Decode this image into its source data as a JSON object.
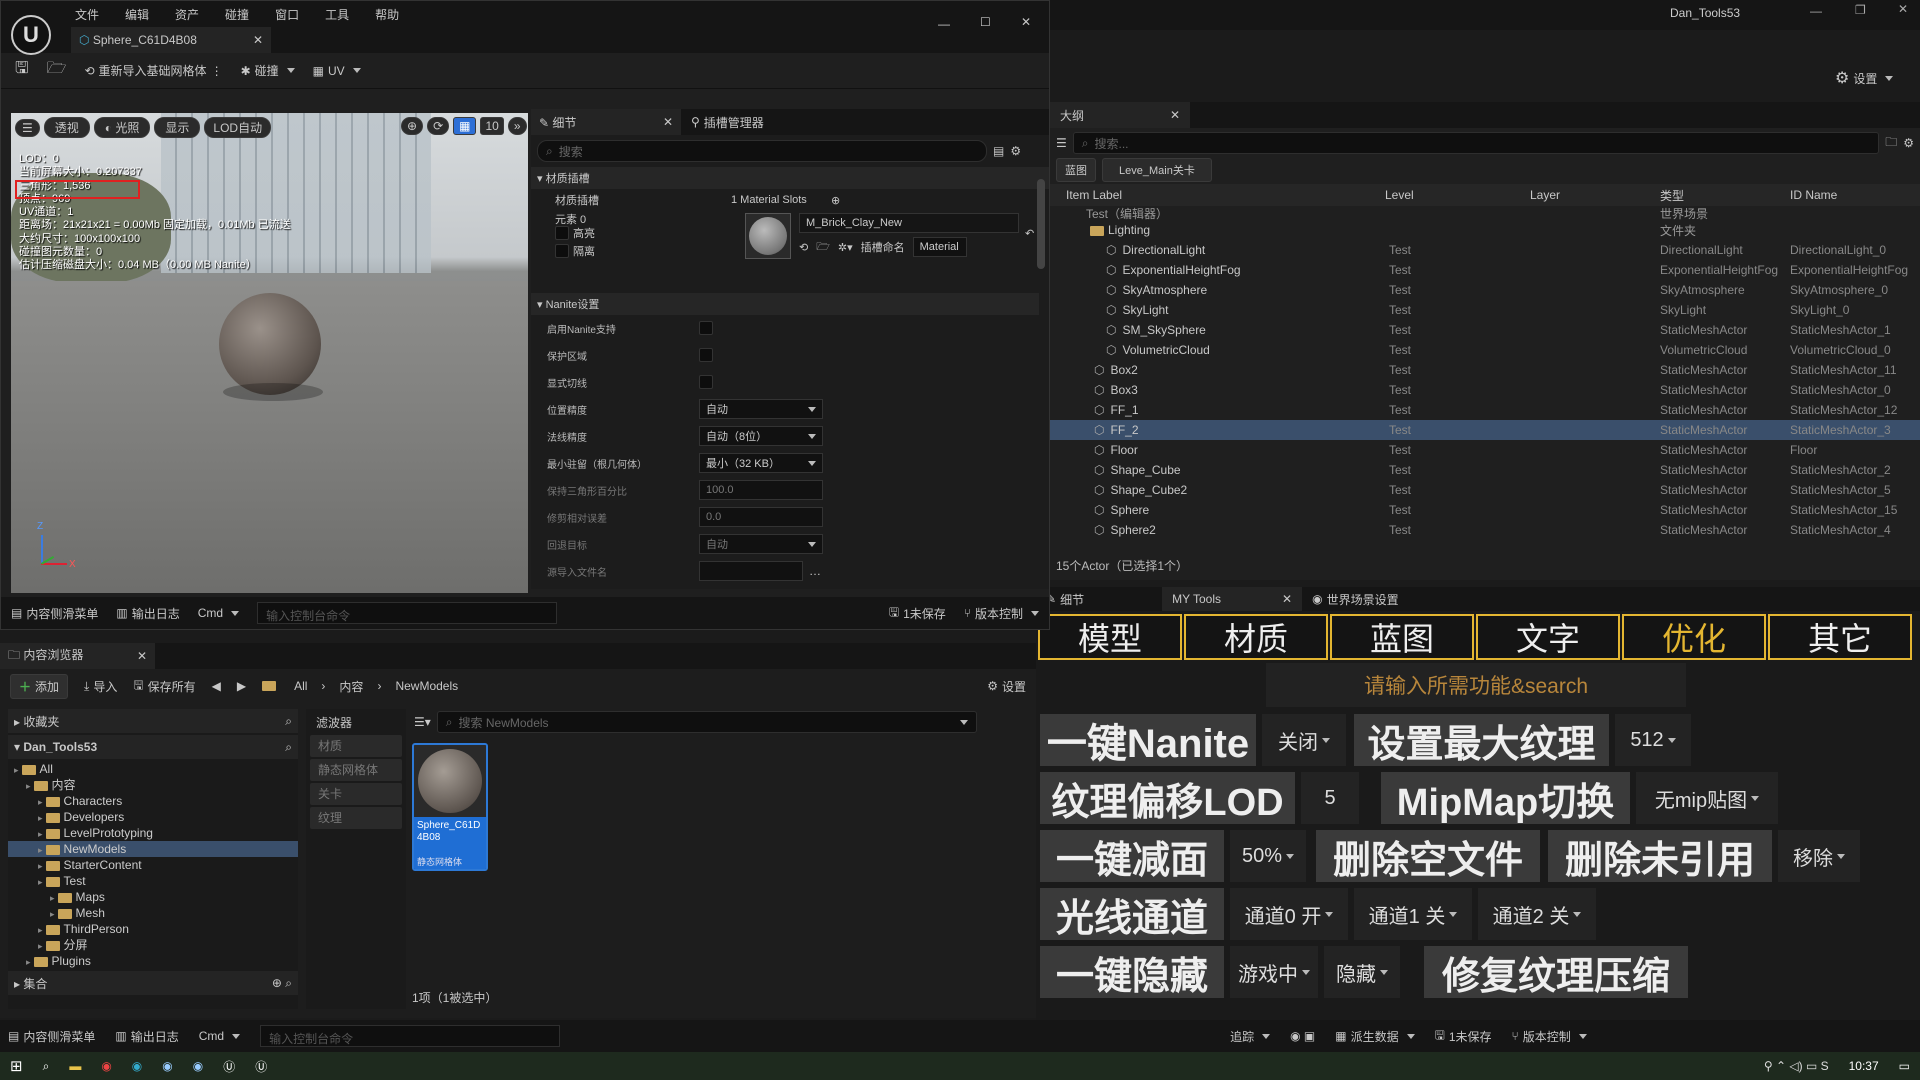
{
  "menu": [
    "文件",
    "编辑",
    "资产",
    "碰撞",
    "窗口",
    "工具",
    "帮助"
  ],
  "editor_tab": "Sphere_C61D4B08",
  "toolbar": {
    "reimport": "重新导入基础网格体",
    "collision": "碰撞",
    "uv": "UV"
  },
  "viewport": {
    "perspective": "透视",
    "lit": "光照",
    "show": "显示",
    "lod_auto": "LOD自动",
    "grid_val": "10",
    "stats": [
      "LOD：0",
      "当前屏幕大小：0.207337",
      "三角形：1,536",
      "顶点：969",
      "UV通道：1",
      "距离场：21x21x21 = 0.00Mb 固定加载，0.01Mb 已流送",
      "大约尺寸：100x100x100",
      "碰撞图元数量：0",
      "估计压缩磁盘大小：0.04 MB（0.00 MB Nanite）"
    ]
  },
  "details": {
    "tab": "细节",
    "plugin_tab": "插槽管理器",
    "search": "搜索",
    "sec_material": "材质插槽",
    "mat_slots_label": "材质插槽",
    "mat_slots_val": "1 Material Slots",
    "element": "元素 0",
    "highlight": "高亮",
    "isolate": "隔离",
    "mat_name": "M_Brick_Clay_New",
    "slot_name_label": "插槽命名",
    "slot_name_val": "Material",
    "sec_nanite": "Nanite设置",
    "rows": [
      {
        "label": "启用Nanite支持",
        "type": "check"
      },
      {
        "label": "保护区域",
        "type": "check"
      },
      {
        "label": "显式切线",
        "type": "check"
      },
      {
        "label": "位置精度",
        "type": "dd",
        "val": "自动"
      },
      {
        "label": "法线精度",
        "type": "dd",
        "val": "自动（8位）"
      },
      {
        "label": "最小驻留（根几何体）",
        "type": "dd",
        "val": "最小（32 KB）"
      },
      {
        "label": "保持三角形百分比",
        "type": "num",
        "val": "100.0"
      },
      {
        "label": "修剪相对误差",
        "type": "num",
        "val": "0.0"
      },
      {
        "label": "回退目标",
        "type": "dd",
        "val": "自动"
      },
      {
        "label": "源导入文件名",
        "type": "file",
        "val": ""
      }
    ]
  },
  "bottom1": {
    "drawer": "内容侧滑菜单",
    "log": "输出日志",
    "cmd": "Cmd",
    "console": "输入控制台命令",
    "unsaved": "1未保存",
    "vcs": "版本控制"
  },
  "window": {
    "title": "Dan_Tools53",
    "settings": "设置"
  },
  "outliner": {
    "tab": "大纲",
    "search": "搜索...",
    "chip1": "蓝图",
    "chip2": "Leve_Main关卡",
    "cols": [
      "Item Label",
      "Level",
      "Layer",
      "类型",
      "ID Name"
    ],
    "root_label": "Test（编辑器）",
    "root_type": "世界场景",
    "lighting": "Lighting",
    "lighting_type": "文件夹",
    "rows": [
      {
        "n": "DirectionalLight",
        "l": "Test",
        "t": "DirectionalLight",
        "id": "DirectionalLight_0",
        "ind": 1
      },
      {
        "n": "ExponentialHeightFog",
        "l": "Test",
        "t": "ExponentialHeightFog",
        "id": "ExponentialHeightFog",
        "ind": 1
      },
      {
        "n": "SkyAtmosphere",
        "l": "Test",
        "t": "SkyAtmosphere",
        "id": "SkyAtmosphere_0",
        "ind": 1
      },
      {
        "n": "SkyLight",
        "l": "Test",
        "t": "SkyLight",
        "id": "SkyLight_0",
        "ind": 1
      },
      {
        "n": "SM_SkySphere",
        "l": "Test",
        "t": "StaticMeshActor",
        "id": "StaticMeshActor_1",
        "ind": 1
      },
      {
        "n": "VolumetricCloud",
        "l": "Test",
        "t": "VolumetricCloud",
        "id": "VolumetricCloud_0",
        "ind": 1
      },
      {
        "n": "Box2",
        "l": "Test",
        "t": "StaticMeshActor",
        "id": "StaticMeshActor_11",
        "ind": 0
      },
      {
        "n": "Box3",
        "l": "Test",
        "t": "StaticMeshActor",
        "id": "StaticMeshActor_0",
        "ind": 0
      },
      {
        "n": "FF_1",
        "l": "Test",
        "t": "StaticMeshActor",
        "id": "StaticMeshActor_12",
        "ind": 0
      },
      {
        "n": "FF_2",
        "l": "Test",
        "t": "StaticMeshActor",
        "id": "StaticMeshActor_3",
        "ind": 0,
        "sel": true
      },
      {
        "n": "Floor",
        "l": "Test",
        "t": "StaticMeshActor",
        "id": "Floor",
        "ind": 0
      },
      {
        "n": "Shape_Cube",
        "l": "Test",
        "t": "StaticMeshActor",
        "id": "StaticMeshActor_2",
        "ind": 0
      },
      {
        "n": "Shape_Cube2",
        "l": "Test",
        "t": "StaticMeshActor",
        "id": "StaticMeshActor_5",
        "ind": 0
      },
      {
        "n": "Sphere",
        "l": "Test",
        "t": "StaticMeshActor",
        "id": "StaticMeshActor_15",
        "ind": 0
      },
      {
        "n": "Sphere2",
        "l": "Test",
        "t": "StaticMeshActor",
        "id": "StaticMeshActor_4",
        "ind": 0
      }
    ],
    "count": "15个Actor（已选择1个）"
  },
  "right_tabs": {
    "details": "细节",
    "mytools": "MY Tools",
    "world": "世界场景设置"
  },
  "mytools": {
    "tabs": [
      "模型",
      "材质",
      "蓝图",
      "文字",
      "优化",
      "其它"
    ],
    "active": "优化",
    "search": "请输入所需功能&search",
    "nanite": "一键Nanite",
    "nanite_opt": "关闭",
    "max_tex": "设置最大纹理",
    "max_tex_opt": "512",
    "lod": "纹理偏移LOD",
    "lod_val": "5",
    "mip": "MipMap切换",
    "mip_opt": "无mip贴图",
    "reduce": "一键减面",
    "reduce_opt": "50%",
    "del_empty": "删除空文件",
    "del_unref": "删除未引用",
    "remove_opt": "移除",
    "light": "光线通道",
    "ch0": "通道0 开",
    "ch1": "通道1 关",
    "ch2": "通道2 关",
    "hide": "一键隐藏",
    "hide_opt1": "游戏中",
    "hide_opt2": "隐藏",
    "fix": "修复纹理压缩"
  },
  "cb": {
    "tab": "内容浏览器",
    "add": "添加",
    "import": "导入",
    "saveall": "保存所有",
    "path": [
      "All",
      "内容",
      "NewModels"
    ],
    "settings": "设置",
    "favorites": "收藏夹",
    "project": "Dan_Tools53",
    "filters": "滤波器",
    "filter_items": [
      "材质",
      "静态网格体",
      "关卡",
      "纹理"
    ],
    "search": "搜索 NewModels",
    "asset_name": "Sphere_C61D4B08",
    "asset_type": "静态网格体",
    "count": "1项（1被选中）",
    "collections": "集合",
    "tree": [
      {
        "t": "All",
        "d": 0
      },
      {
        "t": "内容",
        "d": 1
      },
      {
        "t": "Characters",
        "d": 2
      },
      {
        "t": "Developers",
        "d": 2
      },
      {
        "t": "LevelPrototyping",
        "d": 2
      },
      {
        "t": "NewModels",
        "d": 2,
        "sel": true
      },
      {
        "t": "StarterContent",
        "d": 2
      },
      {
        "t": "Test",
        "d": 2
      },
      {
        "t": "Maps",
        "d": 3
      },
      {
        "t": "Mesh",
        "d": 3
      },
      {
        "t": "ThirdPerson",
        "d": 2
      },
      {
        "t": "分屏",
        "d": 2
      },
      {
        "t": "Plugins",
        "d": 1
      }
    ]
  },
  "status": {
    "drawer": "内容侧滑菜单",
    "log": "输出日志",
    "cmd": "Cmd",
    "console": "输入控制台命令",
    "trace": "追踪",
    "derived": "派生数据",
    "unsaved": "1未保存",
    "vcs": "版本控制"
  },
  "taskbar": {
    "time": "10:37"
  },
  "colors": {
    "accent": "#e4b631",
    "selection": "#3a4f6b",
    "highlight_box": "#e02020"
  }
}
